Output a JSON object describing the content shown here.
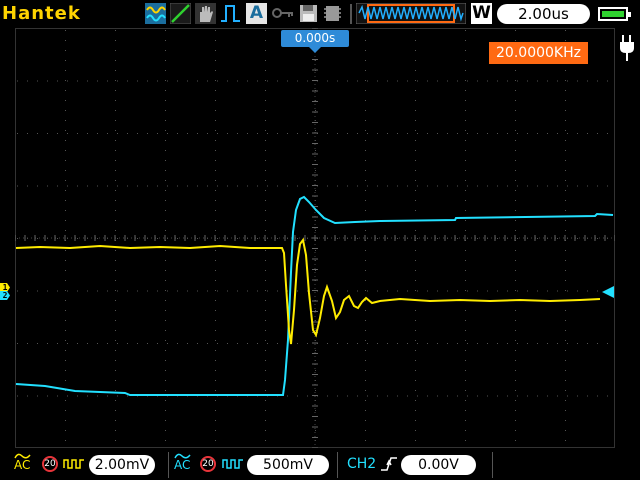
{
  "header": {
    "brand": "Hantek",
    "timebase": "2.00us",
    "acq_mode_letter": "W",
    "auto_label": "A",
    "battery_level": 1.0
  },
  "screen": {
    "trigger_position": "0.000s",
    "frequency": "20.0000KHz",
    "ch1_marker": "1",
    "ch2_marker": "2"
  },
  "footer": {
    "ch1": {
      "coupling": "AC",
      "bw_limit": "20",
      "scale": "2.00mV"
    },
    "ch2": {
      "coupling": "AC",
      "bw_limit": "20",
      "scale": "500mV"
    },
    "trigger": {
      "source": "CH2",
      "level": "0.00V"
    }
  },
  "colors": {
    "brand": "#ffd400",
    "ch1": "#ffec00",
    "ch2": "#22e0ff",
    "frequency_bg": "#ff6a13",
    "trigger_marker": "#2e8bd8",
    "bw_ring": "#e8343a"
  },
  "icons": {
    "sine-wave-icon": "sine",
    "ramp-icon": "ramp",
    "hand-icon": "hand",
    "pulse-icon": "pulse",
    "key-icon": "key",
    "save-icon": "floppy",
    "memory-icon": "memory",
    "waveform-position-icon": "waveform",
    "battery-icon": "battery",
    "power-plug-icon": "plug",
    "ac-coupling-icon": "ac",
    "probe-icon": "probe",
    "rising-edge-icon": "rising-edge"
  }
}
